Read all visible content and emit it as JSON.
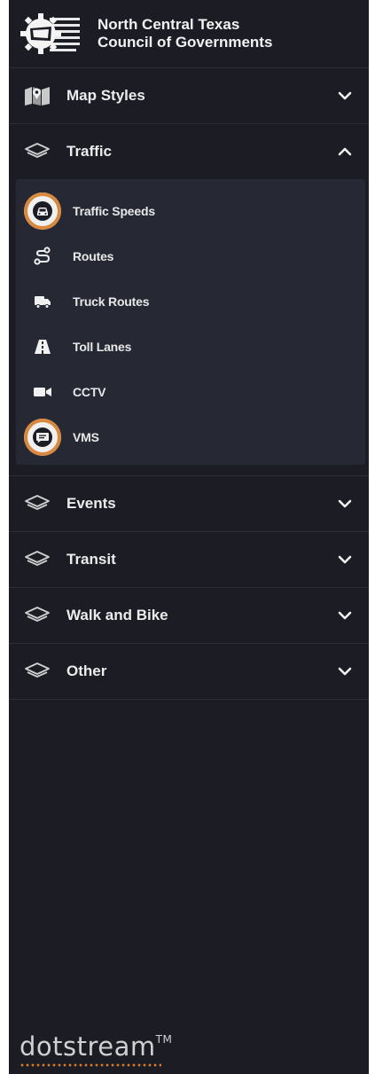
{
  "header": {
    "org_line1": "North Central Texas",
    "org_line2": "Council of Governments",
    "logo_icon": "nctcog-gear-logo"
  },
  "sections": {
    "map_styles": {
      "label": "Map Styles",
      "icon": "map-icon",
      "expanded": false
    },
    "traffic": {
      "label": "Traffic",
      "icon": "layers-icon",
      "expanded": true,
      "items": [
        {
          "label": "Traffic Speeds",
          "icon": "car-icon",
          "active": true
        },
        {
          "label": "Routes",
          "icon": "route-icon",
          "active": false
        },
        {
          "label": "Truck Routes",
          "icon": "truck-icon",
          "active": false
        },
        {
          "label": "Toll Lanes",
          "icon": "road-icon",
          "active": false
        },
        {
          "label": "CCTV",
          "icon": "video-camera-icon",
          "active": false
        },
        {
          "label": "VMS",
          "icon": "message-sign-icon",
          "active": true
        }
      ]
    },
    "events": {
      "label": "Events",
      "icon": "layers-icon",
      "expanded": false
    },
    "transit": {
      "label": "Transit",
      "icon": "layers-icon",
      "expanded": false
    },
    "walk_bike": {
      "label": "Walk and Bike",
      "icon": "layers-icon",
      "expanded": false
    },
    "other": {
      "label": "Other",
      "icon": "layers-icon",
      "expanded": false
    }
  },
  "footer": {
    "brand": "dotstream",
    "trademark": "TM"
  },
  "colors": {
    "background": "#1b1c24",
    "sublist_bg": "#262833",
    "accent": "#d9893d",
    "text": "#ececec"
  }
}
